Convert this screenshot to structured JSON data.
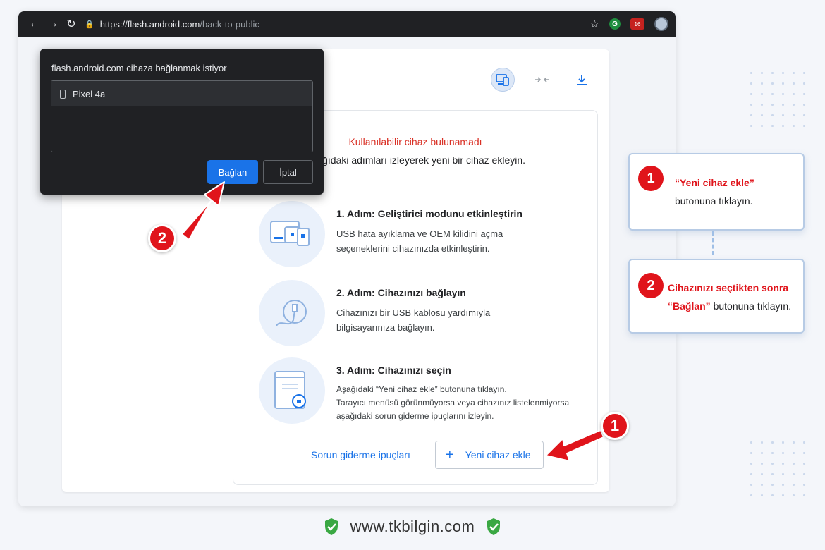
{
  "browser": {
    "url_host": "https://flash.android.com",
    "url_path": "/back-to-public",
    "ext_g": "G",
    "ext_badge": "16"
  },
  "popup": {
    "title": "flash.android.com cihaza bağlanmak istiyor",
    "device": "Pixel 4a",
    "connect_label": "Bağlan",
    "cancel_label": "İptal"
  },
  "main": {
    "no_device": "Kullanılabilir cihaz bulunamadı",
    "instruction": "Aşağıdaki adımları izleyerek yeni bir cihaz ekleyin.",
    "steps": [
      {
        "title": "1. Adım: Geliştirici modunu etkinleştirin",
        "desc": "USB hata ayıklama ve OEM kilidini açma seçeneklerini cihazınızda etkinleştirin."
      },
      {
        "title": "2. Adım: Cihazınızı bağlayın",
        "desc": "Cihazınızı bir USB kablosu yardımıyla bilgisayarınıza bağlayın."
      },
      {
        "title": "3. Adım: Cihazınızı seçin",
        "desc_line1": "Aşağıdaki “Yeni cihaz ekle” butonuna tıklayın.",
        "desc_line2": "Tarayıcı menüsü görünmüyorsa veya cihazınız listelenmiyorsa",
        "desc_line3": "aşağıdaki sorun giderme ipuçlarını izleyin."
      }
    ],
    "tips_link": "Sorun giderme ipuçları",
    "add_button": "Yeni cihaz ekle",
    "add_plus": "+"
  },
  "annotations": {
    "badge1": "1",
    "badge2": "2",
    "card1_line1": "“Yeni cihaz ekle”",
    "card1_line2": "butonuna tıklayın.",
    "card2_part1": "Cihazınızı ",
    "card2_part2": "seçtikten sonra",
    "card2_part3": "“Bağlan”",
    "card2_part4": " butonuna tıklayın."
  },
  "footer": {
    "site": "www.tkbilgin.com"
  },
  "colors": {
    "accent": "#1a73e8",
    "annotation_red": "#e0141b",
    "toolbar": "#202124"
  }
}
